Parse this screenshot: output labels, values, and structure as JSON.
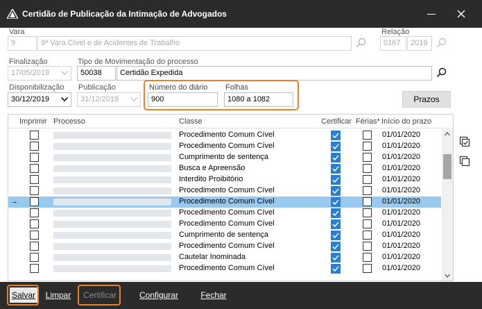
{
  "window": {
    "title": "Certidão de Publicação da Intimação de Advogados"
  },
  "vara": {
    "label": "Vara",
    "code": "9",
    "name": "9ª Vara Cível e de Acidentes de Trabalho"
  },
  "relacao": {
    "label": "Relação",
    "number": "0167",
    "year": "2019"
  },
  "finalizacao": {
    "label": "Finalização",
    "value": "17/05/2019"
  },
  "tipo_mov": {
    "label": "Tipo de Movimentação do processo",
    "code": "50038",
    "name": "Certidão Expedida"
  },
  "disponibilizacao": {
    "label": "Disponibilização",
    "value": "30/12/2019"
  },
  "publicacao": {
    "label": "Publicação",
    "value": "31/12/2019"
  },
  "numero_diario": {
    "label": "Número do diário",
    "value": "900"
  },
  "folhas": {
    "label": "Folhas",
    "value": "1080 a 1082"
  },
  "prazos_button": "Prazos",
  "grid": {
    "columns": {
      "imprimir": "Imprimir",
      "processo": "Processo",
      "classe": "Classe",
      "certificar": "Certificar",
      "ferias": "Férias*",
      "inicio": "Início do prazo"
    },
    "selected_pointer": "→",
    "rows": [
      {
        "classe": "Procedimento Comum Cível",
        "inicio": "01/01/2020"
      },
      {
        "classe": "Procedimento Comum Cível",
        "inicio": "01/01/2020"
      },
      {
        "classe": "Cumprimento de sentença",
        "inicio": "01/01/2020"
      },
      {
        "classe": "Busca e Apreensão",
        "inicio": "01/01/2020"
      },
      {
        "classe": "Interdito Proibitório",
        "inicio": "01/01/2020"
      },
      {
        "classe": "Procedimento Comum Cível",
        "inicio": "01/01/2020"
      },
      {
        "classe": "Procedimento Comum Cível",
        "inicio": "01/01/2020"
      },
      {
        "classe": "Procedimento Comum Cível",
        "inicio": "01/01/2020"
      },
      {
        "classe": "Procedimento Comum Cível",
        "inicio": "01/01/2020"
      },
      {
        "classe": "Cumprimento de sentença",
        "inicio": "01/01/2020"
      },
      {
        "classe": "Procedimento Comum Cível",
        "inicio": "01/01/2020"
      },
      {
        "classe": "Cautelar Inominada",
        "inicio": "01/01/2020"
      },
      {
        "classe": "Procedimento Comum Cível",
        "inicio": "01/01/2020"
      }
    ]
  },
  "bottom": {
    "salvar": "Salvar",
    "limpar": "Limpar",
    "certificar": "Certificar",
    "configurar": "Configurar",
    "fechar": "Fechar"
  },
  "colors": {
    "titlebar": "#2b2b2b",
    "highlight": "#e8822a",
    "selected_row": "#99c9ef",
    "checkbox_checked": "#2a7fd4"
  }
}
